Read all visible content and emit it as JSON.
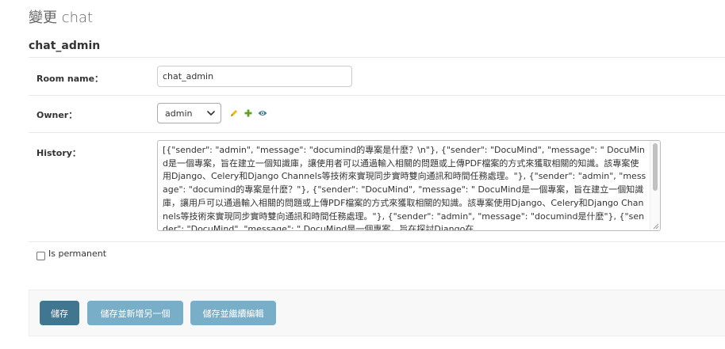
{
  "page_title": "變更 chat",
  "object_name": "chat_admin",
  "fields": {
    "room_name": {
      "label": "Room name：",
      "value": "chat_admin"
    },
    "owner": {
      "label": "Owner：",
      "selected": "admin"
    },
    "history": {
      "label": "History：",
      "value": "[{\"sender\": \"admin\", \"message\": \"documind的專案是什麼？\\n\"}, {\"sender\": \"DocuMind\", \"message\": \" DocuMind是一個專案，旨在建立一個知識庫，讓使用者可以通過輸入相關的問題或上傳PDF檔案的方式來獲取相關的知識。該專案使用Django、Celery和Django Channels等技術來實現同步實時雙向通訊和時間任務處理。\"}, {\"sender\": \"admin\", \"message\": \"documind的專案是什麼？\"}, {\"sender\": \"DocuMind\", \"message\": \" DocuMind是一個專案，旨在建立一個知識庫，讓用戶可以通過輸入相關的問題或上傳PDF檔案的方式來獲取相關的知識。該專案使用Django、Celery和Django Channels等技術來實現同步實時雙向通訊和時間任務處理。\"}, {\"sender\": \"admin\", \"message\": \"documind是什麼\"}, {\"sender\": \"DocuMind\", \"message\": \" DocuMind是一個專案，旨在探討Django在"
    },
    "is_permanent": {
      "label": "Is permanent",
      "checked": false
    }
  },
  "related_icons": {
    "change": "pencil-icon",
    "add": "plus-icon",
    "view": "eye-icon"
  },
  "buttons": {
    "save": "儲存",
    "save_add_another": "儲存並新增另一個",
    "save_continue": "儲存並繼續編輯"
  },
  "colors": {
    "primary_button": "#417690",
    "secondary_button": "#79aec8"
  }
}
